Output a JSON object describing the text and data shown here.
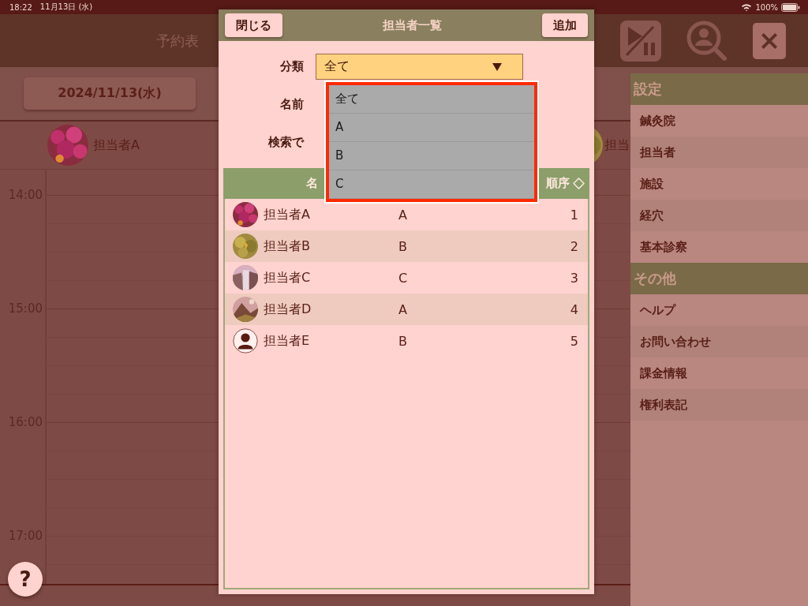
{
  "status_bar": {
    "time": "18:22",
    "date": "11月13日 (水)",
    "battery": "100%"
  },
  "schedule": {
    "title": "予約表",
    "date_button": "2024/11/13(水)",
    "staff": [
      {
        "name": "担当者A"
      },
      {
        "name": "担当"
      }
    ],
    "times": [
      "14:00",
      "15:00",
      "16:00",
      "17:00"
    ],
    "help_button": "?"
  },
  "sidebar": {
    "sections": [
      {
        "title": "設定",
        "items": [
          "鍼灸院",
          "担当者",
          "施設",
          "経穴",
          "基本診察"
        ]
      },
      {
        "title": "その他",
        "items": [
          "ヘルプ",
          "お問い合わせ",
          "課金情報",
          "権利表記"
        ]
      }
    ]
  },
  "dialog": {
    "title": "担当者一覧",
    "close_button": "閉じる",
    "add_button": "追加",
    "category": {
      "label": "分類",
      "value": "全て",
      "expanded": true,
      "options": [
        "全て",
        "A",
        "B",
        "C"
      ]
    },
    "name_label": "名前",
    "search_label": "検索で",
    "table": {
      "columns": [
        "名",
        "順序"
      ],
      "rows": [
        {
          "name": "担当者A",
          "category": "A",
          "order": "1"
        },
        {
          "name": "担当者B",
          "category": "B",
          "order": "2"
        },
        {
          "name": "担当者C",
          "category": "C",
          "order": "3"
        },
        {
          "name": "担当者D",
          "category": "A",
          "order": "4"
        },
        {
          "name": "担当者E",
          "category": "B",
          "order": "5",
          "kind": "silhouette"
        }
      ]
    }
  }
}
